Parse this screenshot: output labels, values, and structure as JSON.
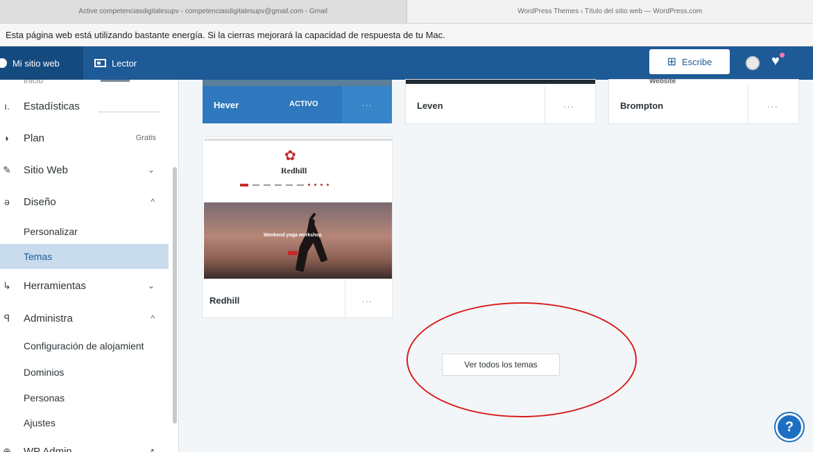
{
  "browser": {
    "tabs": [
      {
        "label": "Active competenciasdigitalesupv - competenciasdigitalesupv@gmail.com - Gmail"
      },
      {
        "label": "WordPress Themes ‹ Título del sitio web — WordPress.com"
      }
    ],
    "energy_warning": "Esta página web está utilizando bastante energía. Si la cierras mejorará la capacidad de respuesta de tu Mac."
  },
  "masterbar": {
    "my_site": "Mi sitio web",
    "reader": "Lector",
    "write": "Escribe",
    "accent_color": "#1d5a96"
  },
  "sidebar": {
    "prev_item": "Inicio",
    "items": [
      {
        "label": "Estadísticas",
        "icon": "bar-chart-icon"
      },
      {
        "label": "Plan",
        "icon": "plan-icon",
        "badge": "Gratis"
      },
      {
        "label": "Sitio Web",
        "icon": "pin-icon"
      },
      {
        "label": "Diseño",
        "icon": "brush-icon"
      },
      {
        "label": "Herramientas",
        "icon": "wrench-icon"
      },
      {
        "label": "Administra",
        "icon": "admin-icon"
      },
      {
        "label": "WP Admin",
        "icon": "wp-admin-icon"
      }
    ],
    "design_sub": [
      {
        "label": "Personalizar"
      },
      {
        "label": "Temas"
      }
    ],
    "admin_sub": [
      {
        "label": "Configuración de alojamient"
      },
      {
        "label": "Dominios"
      },
      {
        "label": "Personas"
      },
      {
        "label": "Ajustes"
      }
    ]
  },
  "themes": [
    {
      "name": "Hever",
      "status": "ACTIVO",
      "more": "···"
    },
    {
      "name": "Leven",
      "more": "···"
    },
    {
      "name": "Brompton",
      "more": "···",
      "preview_text": "Website"
    },
    {
      "name": "Redhill",
      "more": "···"
    }
  ],
  "redhill_preview": {
    "logo": "Redhill",
    "hero_title": "Weekend yoga workshop",
    "lotus_symbol": "✿"
  },
  "view_all_button": "Ver todos los temas",
  "help_button": "?"
}
